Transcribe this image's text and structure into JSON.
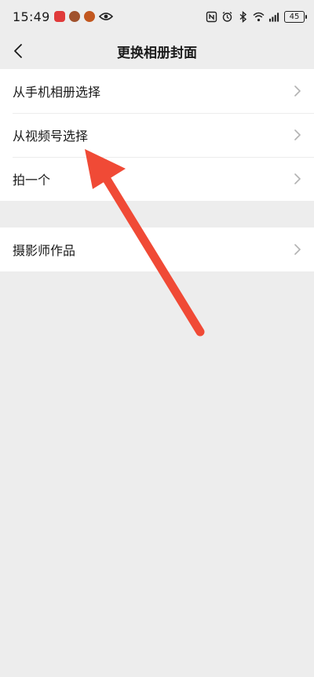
{
  "status_bar": {
    "time": "15:49",
    "battery_level": "45",
    "left_icons": [
      "app-notification-icon",
      "app-notification-icon",
      "app-notification-icon",
      "eye-icon"
    ],
    "right_icons": [
      "nfc-icon",
      "alarm-icon",
      "bluetooth-icon",
      "wifi-icon",
      "signal-icon",
      "battery-icon"
    ]
  },
  "header": {
    "title": "更换相册封面",
    "back_icon": "chevron-left-icon"
  },
  "menu_group_1": [
    {
      "label": "从手机相册选择",
      "icon": "chevron-right-icon"
    },
    {
      "label": "从视频号选择",
      "icon": "chevron-right-icon"
    },
    {
      "label": "拍一个",
      "icon": "chevron-right-icon"
    }
  ],
  "menu_group_2": [
    {
      "label": "摄影师作品",
      "icon": "chevron-right-icon"
    }
  ],
  "annotation": {
    "arrow_color": "#f04a36",
    "points_to": "从视频号选择"
  },
  "colors": {
    "page_background": "#ededed",
    "row_background": "#ffffff",
    "text": "#1a1a1a",
    "chevron": "#b2b2b2"
  }
}
